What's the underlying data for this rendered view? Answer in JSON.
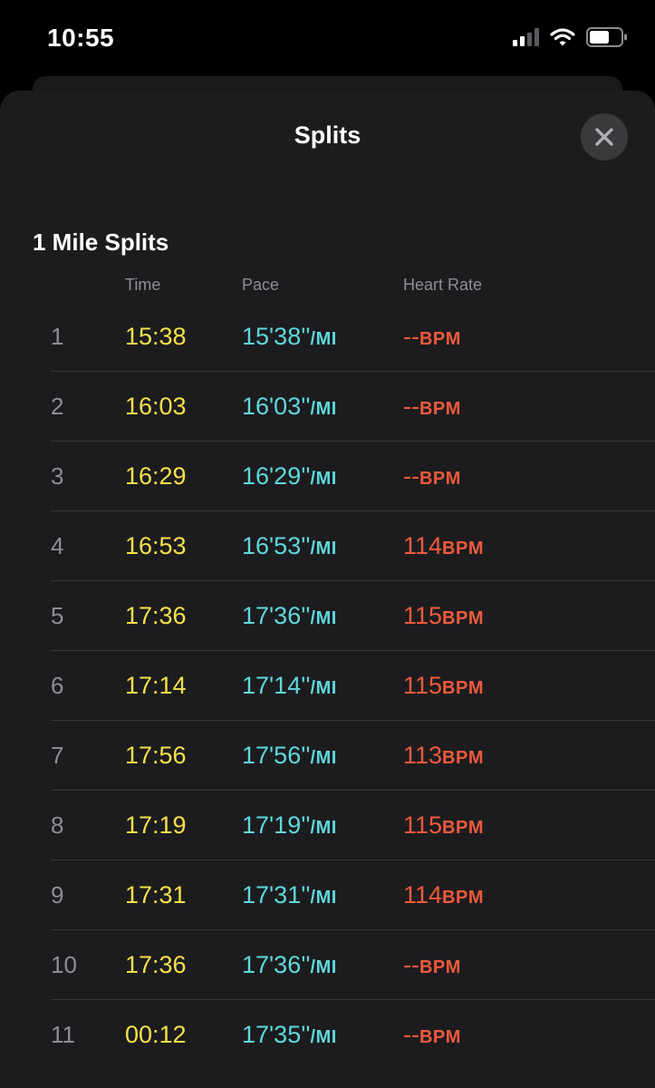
{
  "status_bar": {
    "time": "10:55",
    "icons": [
      "cellular-signal-icon",
      "wifi-icon",
      "battery-icon"
    ]
  },
  "sheet": {
    "title": "Splits",
    "close_icon": "close-icon"
  },
  "splits": {
    "section_title": "1 Mile Splits",
    "columns": {
      "time": "Time",
      "pace": "Pace",
      "heart_rate": "Heart Rate"
    },
    "pace_unit": "/MI",
    "hr_unit": "BPM",
    "rows": [
      {
        "index": "1",
        "time": "15:38",
        "pace": "15'38''",
        "hr": "--"
      },
      {
        "index": "2",
        "time": "16:03",
        "pace": "16'03''",
        "hr": "--"
      },
      {
        "index": "3",
        "time": "16:29",
        "pace": "16'29''",
        "hr": "--"
      },
      {
        "index": "4",
        "time": "16:53",
        "pace": "16'53''",
        "hr": "114"
      },
      {
        "index": "5",
        "time": "17:36",
        "pace": "17'36''",
        "hr": "115"
      },
      {
        "index": "6",
        "time": "17:14",
        "pace": "17'14''",
        "hr": "115"
      },
      {
        "index": "7",
        "time": "17:56",
        "pace": "17'56''",
        "hr": "113"
      },
      {
        "index": "8",
        "time": "17:19",
        "pace": "17'19''",
        "hr": "115"
      },
      {
        "index": "9",
        "time": "17:31",
        "pace": "17'31''",
        "hr": "114"
      },
      {
        "index": "10",
        "time": "17:36",
        "pace": "17'36''",
        "hr": "--"
      },
      {
        "index": "11",
        "time": "00:12",
        "pace": "17'35''",
        "hr": "--"
      }
    ]
  },
  "colors": {
    "time": "#f5e04a",
    "pace": "#5ed8dc",
    "heart_rate": "#ef5a3d",
    "sheet_background": "#1c1c1e"
  }
}
